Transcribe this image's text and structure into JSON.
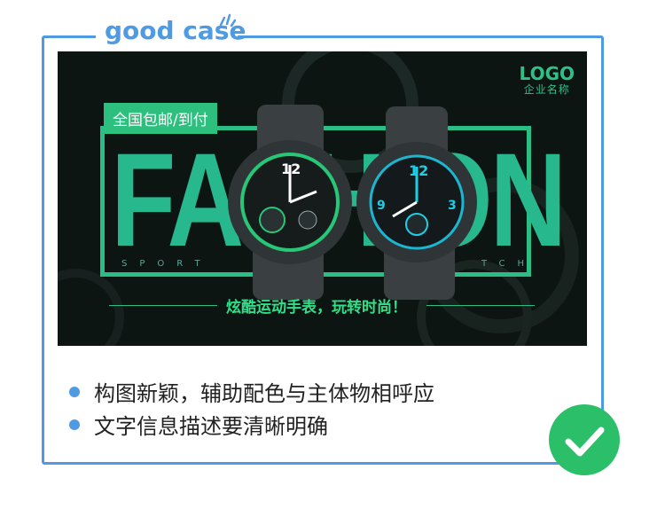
{
  "header": {
    "title": "good case"
  },
  "banner": {
    "logo": "LOGO",
    "company": "企业名称",
    "tag": "全国包邮/到付",
    "headline": "FASHION",
    "sport_left": "SPORT",
    "sport_right": "TCH",
    "slogan": "炫酷运动手表，玩转时尚！"
  },
  "bullets": [
    {
      "text": "构图新颖，辅助配色与主体物相呼应"
    },
    {
      "text": "文字信息描述要清晰明确"
    }
  ],
  "colors": {
    "accent": "#4f9be3",
    "brand_green": "#2bbd86",
    "check_green": "#2bbf6a"
  }
}
